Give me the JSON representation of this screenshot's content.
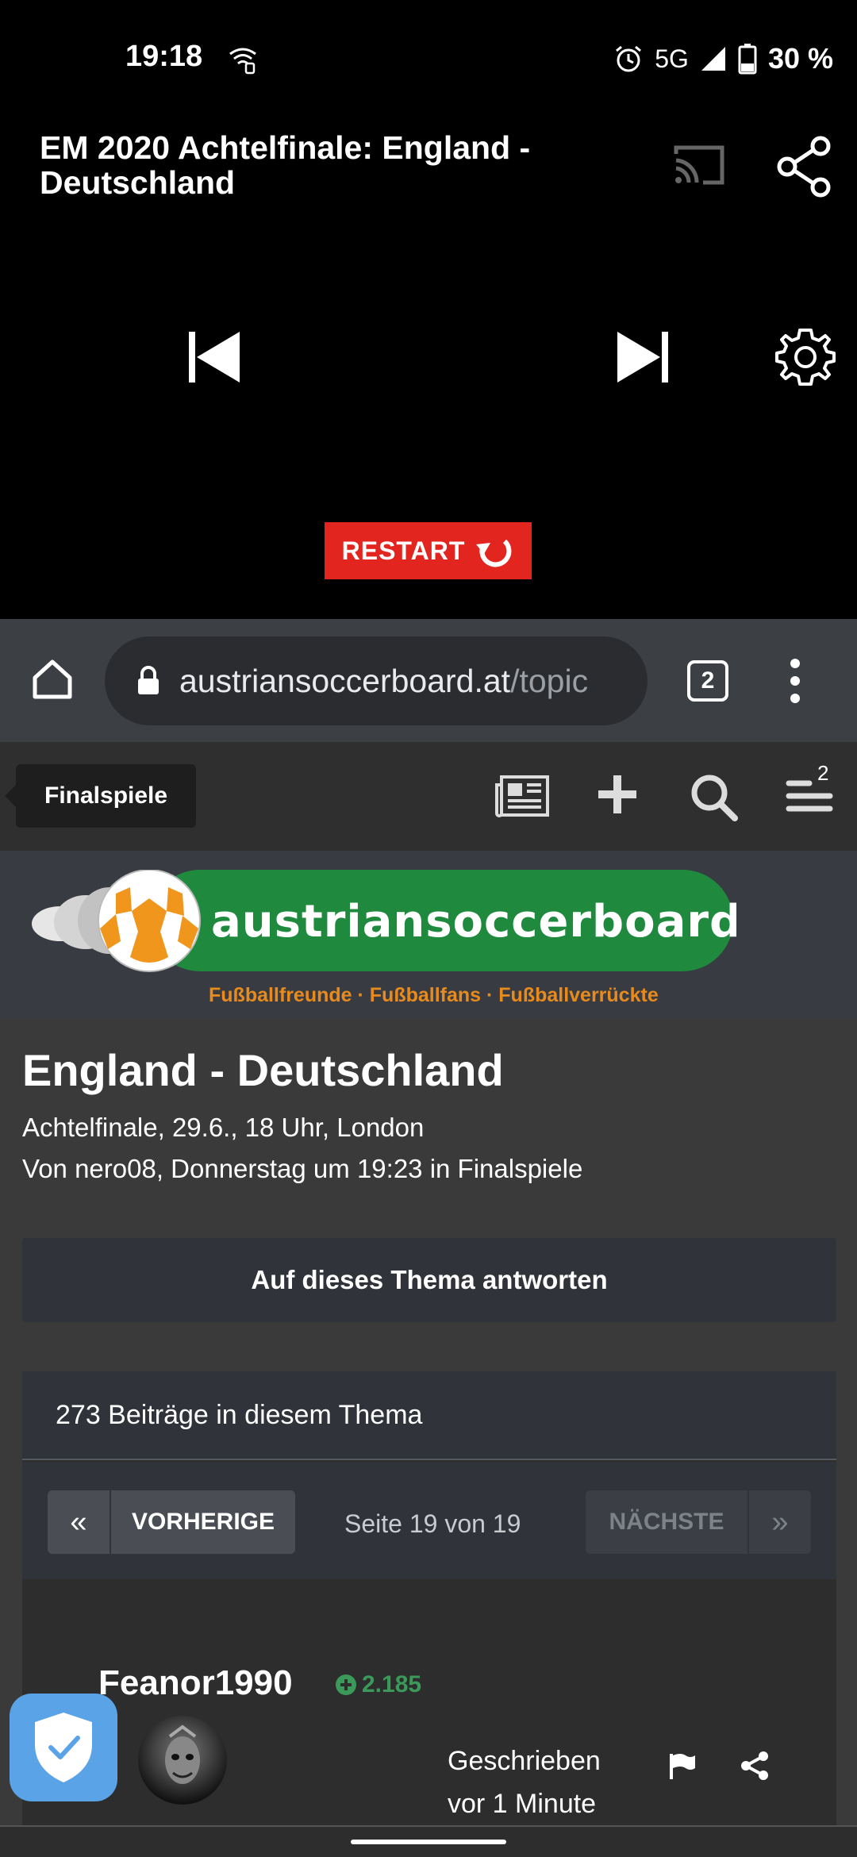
{
  "status_bar": {
    "time": "19:18",
    "network": "5G",
    "battery": "30 %",
    "icons": [
      "wifi-call-icon",
      "alarm-icon",
      "signal-icon",
      "battery-icon"
    ]
  },
  "player": {
    "title": "EM 2020 Achtelfinale: England - Deutschland",
    "restart_label": "RESTART",
    "restart_color": "#e3251f",
    "icons": [
      "cast-icon",
      "share-icon",
      "previous-icon",
      "next-icon",
      "settings-icon",
      "restart-icon",
      "exit-fullscreen-icon"
    ]
  },
  "browser": {
    "url_host": "austriansoccerboard.at",
    "url_path": "/topic",
    "tab_count": "2",
    "icons": [
      "home-icon",
      "lock-icon",
      "menu-icon"
    ]
  },
  "forum_nav": {
    "breadcrumb": "Finalspiele",
    "menu_badge": "2",
    "icons": [
      "news-icon",
      "plus-icon",
      "search-icon",
      "menu-icon"
    ]
  },
  "banner": {
    "site_name": "austriansoccerboard.at",
    "tagline": "Fußballfreunde · Fußballfans · Fußballverrückte",
    "brand_green": "#1f8a3e",
    "tagline_color": "#e88b1c"
  },
  "topic": {
    "title": "England - Deutschland",
    "subtitle": "Achtelfinale, 29.6., 18 Uhr, London",
    "meta": "Von nero08, Donnerstag um 19:23 in Finalspiele",
    "reply_label": "Auf dieses Thema antworten"
  },
  "posts": {
    "count_label": "273 Beiträge in diesem Thema",
    "pagination": {
      "first": "«",
      "prev": "VORHERIGE",
      "info": "Seite 19 von 19",
      "next": "NÄCHSTE",
      "last": "»"
    },
    "first_post": {
      "author": "Feanor1990",
      "reputation": "2.185",
      "written": "Geschrieben vor 1 Minute",
      "written_line1": "Geschrieben",
      "written_line2": "vor 1 Minute"
    }
  }
}
